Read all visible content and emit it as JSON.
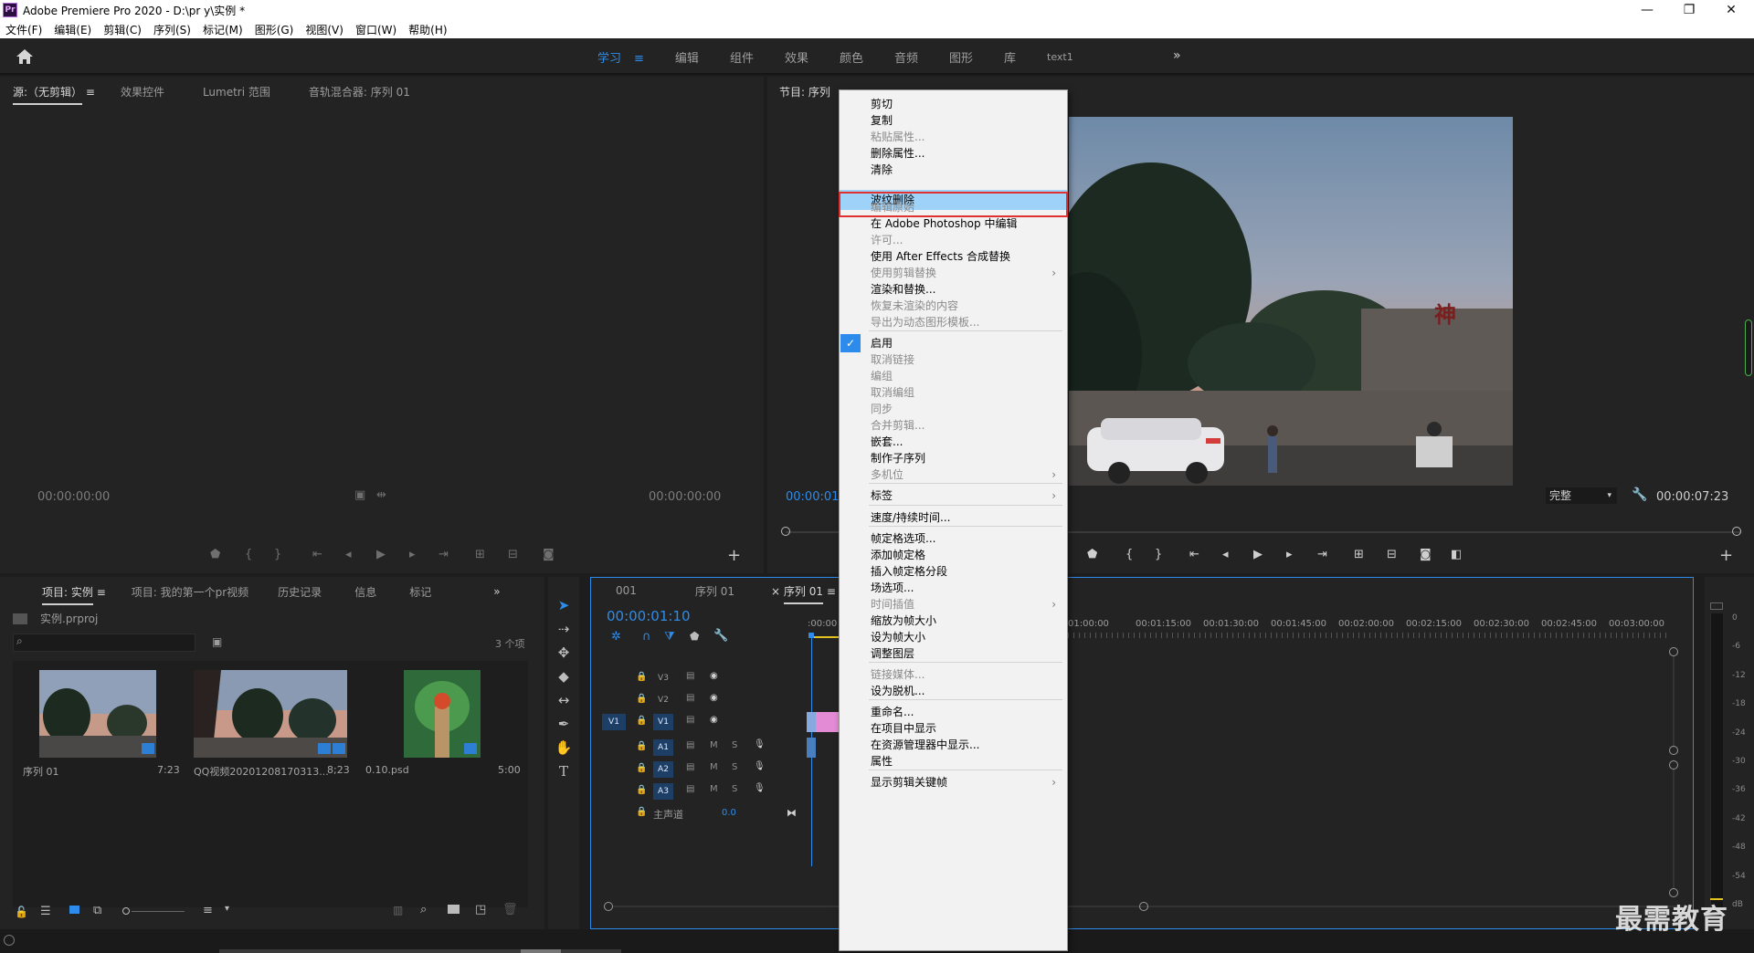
{
  "window": {
    "app_icon_text": "Pr",
    "title": "Adobe Premiere Pro 2020 - D:\\pr y\\实例 *",
    "controls": {
      "minimize": "—",
      "maximize": "❐",
      "close": "✕"
    }
  },
  "menubar": {
    "items": [
      "文件(F)",
      "编辑(E)",
      "剪辑(C)",
      "序列(S)",
      "标记(M)",
      "图形(G)",
      "视图(V)",
      "窗口(W)",
      "帮助(H)"
    ]
  },
  "workspaces": {
    "tabs": [
      "学习",
      "编辑",
      "组件",
      "效果",
      "颜色",
      "音频",
      "图形",
      "库",
      "text1"
    ],
    "active_index": 0,
    "more": "»"
  },
  "source_panel": {
    "tabs": [
      "源:（无剪辑）",
      "效果控件",
      "Lumetri 范围",
      "音轨混合器: 序列 01"
    ],
    "timecode_left": "00:00:00:00",
    "timecode_right": "00:00:00:00"
  },
  "program_panel": {
    "title": "节目: 序列",
    "timecode_left": "00:00:01",
    "fit": "完整",
    "duration": "00:00:07:23",
    "signage_text": "神"
  },
  "project_panel": {
    "tabs": [
      "项目: 实例",
      "项目: 我的第一个pr视频",
      "历史记录",
      "信息",
      "标记"
    ],
    "more": "»",
    "project_file": "实例.prproj",
    "item_count": "3 个项",
    "items": [
      {
        "name": "序列 01",
        "duration": "7:23"
      },
      {
        "name": "QQ视频20201208170313...",
        "duration": "8;23"
      },
      {
        "name": "0.10.psd",
        "duration": "5:00"
      }
    ]
  },
  "timeline": {
    "tabs": [
      "001",
      "序列 01",
      "序列 01"
    ],
    "close_mark": "×",
    "timecode": "00:00:01:10",
    "ruler_start": ":00:00",
    "ruler": [
      "01:00:00",
      "00:01:15:00",
      "00:01:30:00",
      "00:01:45:00",
      "00:02:00:00",
      "00:02:15:00",
      "00:02:30:00",
      "00:02:45:00",
      "00:03:00:00"
    ],
    "video_tracks": [
      "V3",
      "V2",
      "V1"
    ],
    "source_patch": "V1",
    "audio_tracks": [
      "A1",
      "A2",
      "A3"
    ],
    "mute": "M",
    "solo": "S",
    "master_label": "主声道",
    "master_value": "0.0"
  },
  "meter": {
    "labels": [
      "0",
      "-6",
      "-12",
      "-18",
      "-24",
      "-30",
      "-36",
      "-42",
      "-48",
      "-54",
      "dB"
    ]
  },
  "context_menu": {
    "items": [
      {
        "label": "剪切",
        "enabled": true
      },
      {
        "label": "复制",
        "enabled": true
      },
      {
        "label": "粘贴属性...",
        "enabled": false
      },
      {
        "label": "删除属性...",
        "enabled": true
      },
      {
        "label": "清除",
        "enabled": true
      },
      {
        "label": "波纹删除",
        "enabled": true,
        "highlighted": true
      },
      {
        "label": "编辑原始",
        "enabled": false
      },
      {
        "label": "在 Adobe Photoshop 中编辑",
        "enabled": true
      },
      {
        "label": "许可...",
        "enabled": false
      },
      {
        "label": "使用 After Effects 合成替换",
        "enabled": true
      },
      {
        "label": "使用剪辑替换",
        "enabled": false,
        "submenu": true
      },
      {
        "label": "渲染和替换...",
        "enabled": true
      },
      {
        "label": "恢复未渲染的内容",
        "enabled": false
      },
      {
        "label": "导出为动态图形模板...",
        "enabled": false
      },
      {
        "label": "启用",
        "enabled": true,
        "checked": true
      },
      {
        "label": "取消链接",
        "enabled": false
      },
      {
        "label": "编组",
        "enabled": false
      },
      {
        "label": "取消编组",
        "enabled": false
      },
      {
        "label": "同步",
        "enabled": false
      },
      {
        "label": "合并剪辑...",
        "enabled": false
      },
      {
        "label": "嵌套...",
        "enabled": true
      },
      {
        "label": "制作子序列",
        "enabled": true
      },
      {
        "label": "多机位",
        "enabled": false,
        "submenu": true
      },
      {
        "label": "标签",
        "enabled": true,
        "submenu": true
      },
      {
        "label": "速度/持续时间...",
        "enabled": true
      },
      {
        "label": "帧定格选项...",
        "enabled": true
      },
      {
        "label": "添加帧定格",
        "enabled": true
      },
      {
        "label": "插入帧定格分段",
        "enabled": true
      },
      {
        "label": "场选项...",
        "enabled": true
      },
      {
        "label": "时间插值",
        "enabled": false,
        "submenu": true
      },
      {
        "label": "缩放为帧大小",
        "enabled": true
      },
      {
        "label": "设为帧大小",
        "enabled": true
      },
      {
        "label": "调整图层",
        "enabled": true
      },
      {
        "label": "链接媒体...",
        "enabled": false
      },
      {
        "label": "设为脱机...",
        "enabled": true
      },
      {
        "label": "重命名...",
        "enabled": true
      },
      {
        "label": "在项目中显示",
        "enabled": true
      },
      {
        "label": "在资源管理器中显示...",
        "enabled": true
      },
      {
        "label": "属性",
        "enabled": true
      },
      {
        "label": "显示剪辑关键帧",
        "enabled": true,
        "submenu": true
      }
    ]
  },
  "watermark": "最需教育",
  "colors": {
    "accent": "#2d8ceb",
    "highlight_box": "#e03131",
    "menu_selection": "#9fd2f8",
    "clip_pink": "#e48bd5"
  }
}
